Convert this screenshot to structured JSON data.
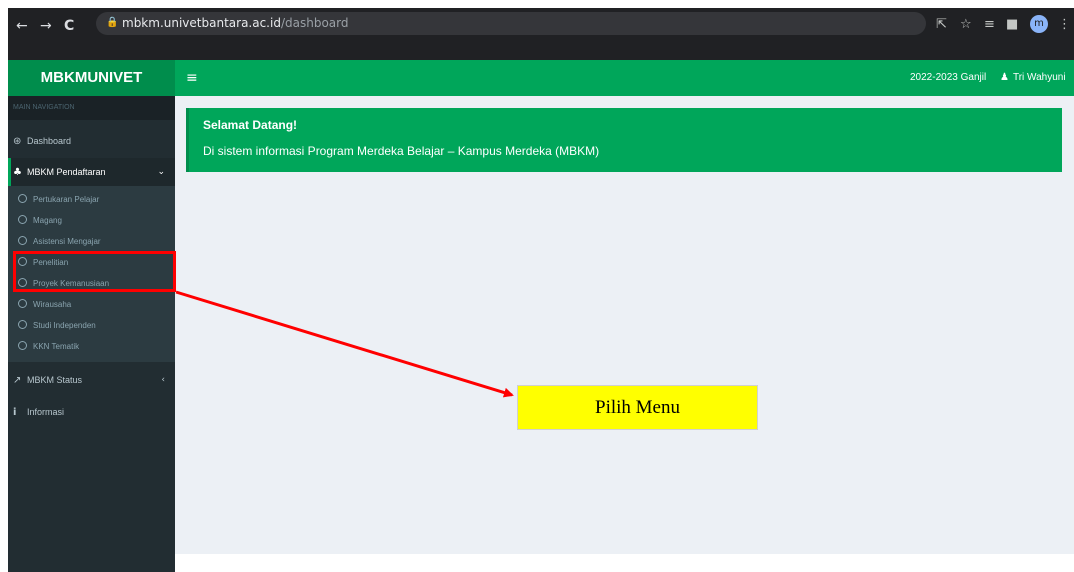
{
  "browser": {
    "url_host": "mbkm.univetbantara.ac.id",
    "url_path": "/dashboard",
    "back_icon": "←",
    "forward_icon": "→",
    "reload_icon": "C",
    "lock_icon": "🔒",
    "share_icon": "⇱",
    "star_icon": "☆",
    "queue_icon": "≡",
    "sidebar_icon": "■",
    "profile_initial": "m",
    "menu_icon": "⋮"
  },
  "header": {
    "logo_prefix": "MBKM",
    "logo_bold": "UNIVET",
    "toggle_icon": "≡",
    "period": "2022-2023 Ganjil",
    "user_icon": "♟",
    "user_name": "Tri Wahyuni"
  },
  "sidebar": {
    "section_label": "MAIN NAVIGATION",
    "items": [
      {
        "icon": "⊛",
        "label": "Dashboard"
      },
      {
        "icon": "♣",
        "label": "MBKM Pendaftaran",
        "chevron": "⌄"
      },
      {
        "icon": "↗",
        "label": "MBKM Status",
        "chevron": "‹"
      },
      {
        "icon": "i",
        "label": "Informasi"
      }
    ],
    "submenu": [
      "Pertukaran Pelajar",
      "Magang",
      "Asistensi Mengajar",
      "Penelitian",
      "Proyek Kemanusiaan",
      "Wirausaha",
      "Studi Independen",
      "KKN Tematik"
    ]
  },
  "welcome": {
    "title": "Selamat Datang!",
    "text": "Di sistem informasi Program Merdeka Belajar – Kampus Merdeka (MBKM)"
  },
  "annotation": {
    "label": "Pilih Menu",
    "color": "#ff0000"
  },
  "colors": {
    "primary_green": "#00a65a",
    "sidebar_dark": "#222d32",
    "callout_yellow": "#ffff00"
  }
}
